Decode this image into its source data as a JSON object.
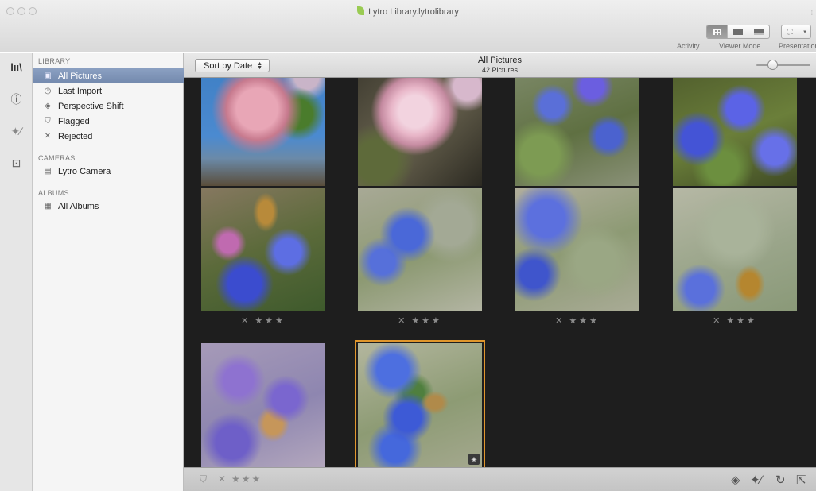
{
  "window": {
    "title": "Lytro Library.lytrolibrary"
  },
  "toolbar": {
    "activity_label": "Activity",
    "viewer_mode_label": "Viewer Mode",
    "presentation_label": "Presentation"
  },
  "sidebar": {
    "library_title": "LIBRARY",
    "library_items": [
      {
        "label": "All Pictures",
        "icon": "photo-icon"
      },
      {
        "label": "Last Import",
        "icon": "clock-icon"
      },
      {
        "label": "Perspective Shift",
        "icon": "perspective-icon"
      },
      {
        "label": "Flagged",
        "icon": "flag-icon"
      },
      {
        "label": "Rejected",
        "icon": "x-icon"
      }
    ],
    "cameras_title": "CAMERAS",
    "camera_items": [
      {
        "label": "Lytro Camera",
        "icon": "camera-icon"
      }
    ],
    "albums_title": "ALBUMS",
    "album_items": [
      {
        "label": "All Albums",
        "icon": "albums-grid-icon"
      }
    ]
  },
  "viewer": {
    "sort_label": "Sort by Date",
    "title": "All Pictures",
    "subtitle": "42 Pictures",
    "zoom_level": 0.3
  },
  "thumbnails": [
    {
      "palette": "p-magnolia1",
      "rating_reject": "✕",
      "rating_stars": "★★★",
      "selected": false
    },
    {
      "palette": "p-magnolia2",
      "rating_reject": "✕",
      "rating_stars": "★★★",
      "selected": false
    },
    {
      "palette": "p-blue1",
      "rating_reject": "✕",
      "rating_stars": "★★★",
      "selected": false
    },
    {
      "palette": "p-blue2",
      "rating_reject": "✕",
      "rating_stars": "★★★",
      "selected": false
    },
    {
      "palette": "p-bee1",
      "rating_reject": "✕",
      "rating_stars": "★★★",
      "selected": false
    },
    {
      "palette": "p-blur1",
      "rating_reject": "✕",
      "rating_stars": "★★★",
      "selected": false
    },
    {
      "palette": "p-blur2",
      "rating_reject": "✕",
      "rating_stars": "★★★",
      "selected": false
    },
    {
      "palette": "p-blur3",
      "rating_reject": "✕",
      "rating_stars": "★★★",
      "selected": false
    },
    {
      "palette": "p-purple",
      "rating_reject": "",
      "rating_stars": "",
      "selected": false
    },
    {
      "palette": "p-bee2",
      "rating_reject": "",
      "rating_stars": "",
      "selected": true
    }
  ],
  "bottom_bar": {
    "reject": "✕",
    "stars": "★★★"
  },
  "colors": {
    "selection_outline": "#e0962c",
    "sidebar_selected": "#7f95b8",
    "grid_background": "#1e1e1e"
  }
}
